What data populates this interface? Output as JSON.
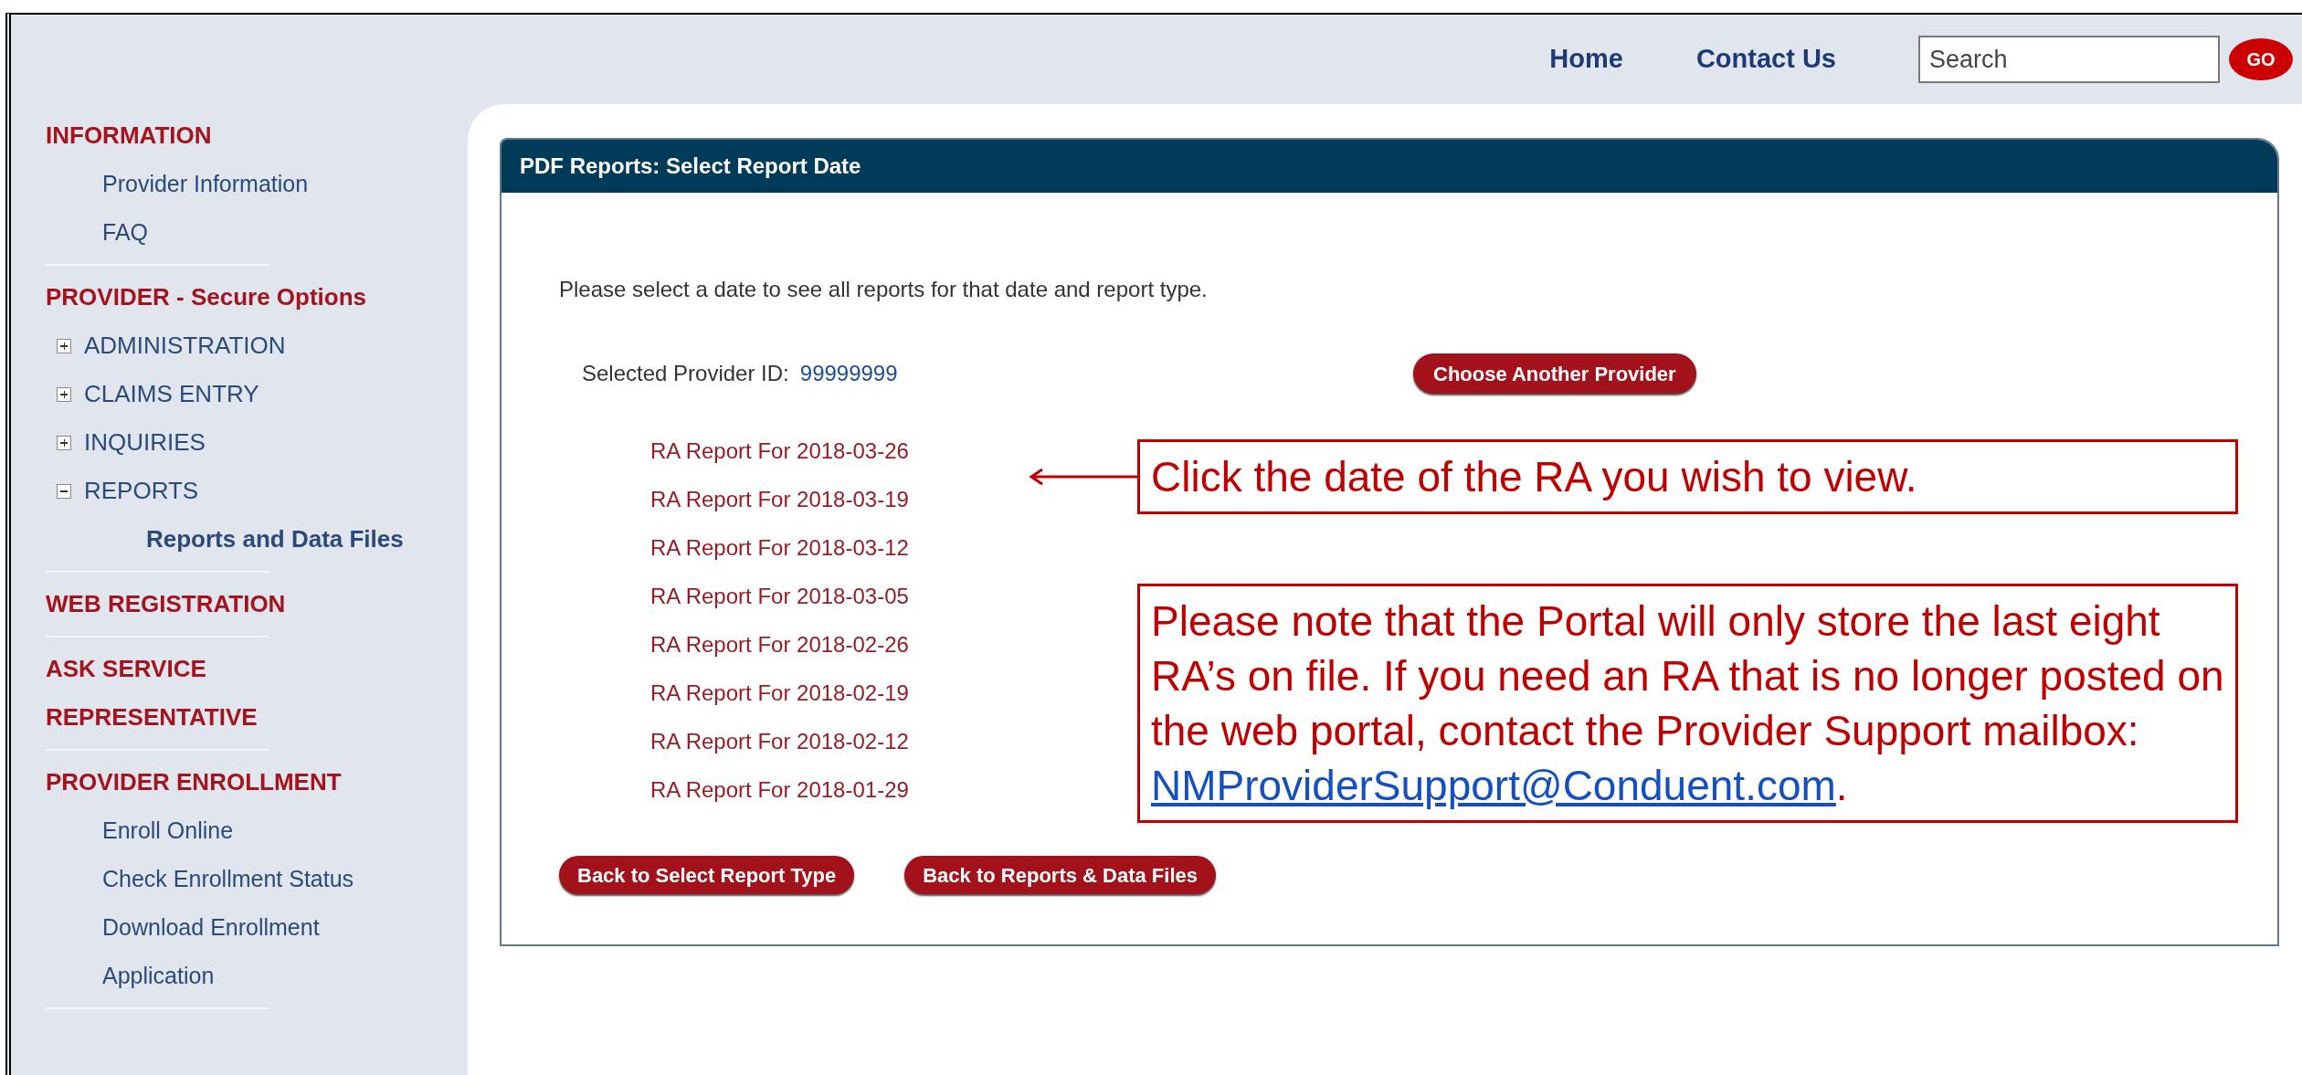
{
  "header": {
    "nav": [
      {
        "label": "Home"
      },
      {
        "label": "Contact Us"
      }
    ],
    "search": {
      "placeholder": "Search",
      "button": "GO"
    }
  },
  "sidebar": {
    "sections": [
      {
        "heading": [
          "INFORMATION"
        ],
        "items": [
          {
            "kind": "link",
            "label": "Provider Information"
          },
          {
            "kind": "link",
            "label": "FAQ"
          }
        ]
      },
      {
        "heading": [
          "PROVIDER - Secure Options"
        ],
        "items": [
          {
            "kind": "toggle",
            "label": "ADMINISTRATION",
            "expanded": false
          },
          {
            "kind": "toggle",
            "label": "CLAIMS ENTRY",
            "expanded": false
          },
          {
            "kind": "toggle",
            "label": "INQUIRIES",
            "expanded": false
          },
          {
            "kind": "toggle",
            "label": "REPORTS",
            "expanded": true,
            "children": [
              {
                "kind": "sublink",
                "label": "Reports and Data Files"
              }
            ]
          }
        ]
      },
      {
        "heading": [
          "WEB REGISTRATION"
        ]
      },
      {
        "heading": [
          "ASK SERVICE",
          "REPRESENTATIVE"
        ]
      },
      {
        "heading": [
          "PROVIDER ENROLLMENT"
        ],
        "items": [
          {
            "kind": "link",
            "label": "Enroll Online"
          },
          {
            "kind": "link",
            "label": "Check Enrollment Status"
          },
          {
            "kind": "link",
            "label": "Download Enrollment Application"
          }
        ]
      }
    ]
  },
  "panel": {
    "title": "PDF Reports: Select Report Date",
    "instruction": "Please select a date to see all reports for that date and report type.",
    "provider": {
      "label": "Selected Provider ID:",
      "value": "99999999"
    },
    "choose_button": "Choose Another Provider",
    "reports": [
      "RA Report For 2018-03-26",
      "RA Report For 2018-03-19",
      "RA Report For 2018-03-12",
      "RA Report For 2018-03-05",
      "RA Report For 2018-02-26",
      "RA Report For 2018-02-19",
      "RA Report For 2018-02-12",
      "RA Report For 2018-01-29"
    ],
    "buttons": [
      "Back to Select Report Type",
      "Back to Reports & Data Files"
    ]
  },
  "callouts": [
    {
      "text": "Click the date of the RA you wish to view.",
      "arrow": true
    },
    {
      "text": "Please note that the Portal will only store the last eight RA’s on file. If you need an RA that is no longer posted on the web portal, contact the Provider Support mailbox: ",
      "link": "NMProviderSupport@Conduent.com",
      "after": ".",
      "arrow": false
    }
  ]
}
